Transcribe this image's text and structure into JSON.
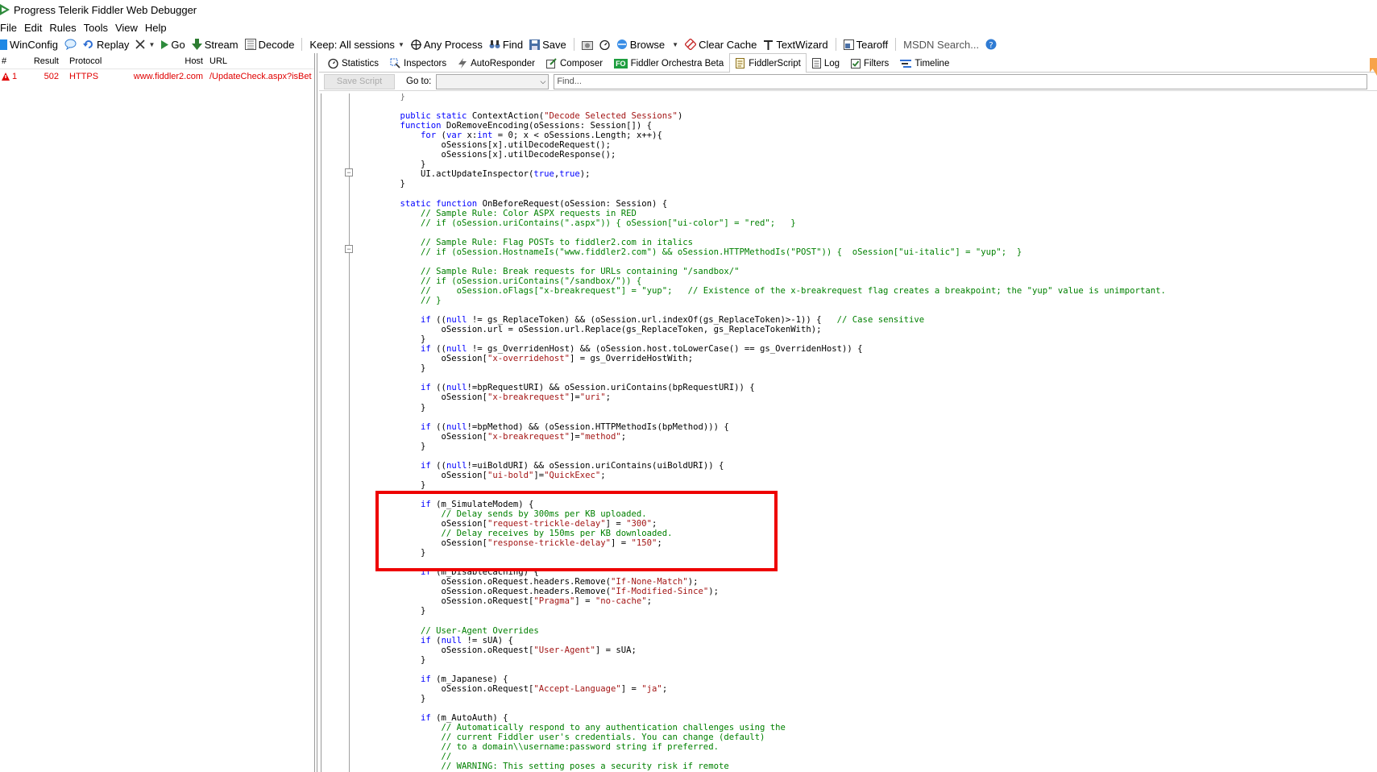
{
  "window": {
    "title": "Progress Telerik Fiddler Web Debugger",
    "icon": "fiddler-logo-icon"
  },
  "menu": [
    "File",
    "Edit",
    "Rules",
    "Tools",
    "View",
    "Help"
  ],
  "toolbar": {
    "winconfig": "WinConfig",
    "replay": "Replay",
    "go": "Go",
    "stream": "Stream",
    "decode": "Decode",
    "keep": "Keep: All sessions",
    "any_process": "Any Process",
    "find": "Find",
    "save": "Save",
    "browse": "Browse",
    "clear_cache": "Clear Cache",
    "textwizard": "TextWizard",
    "tearoff": "Tearoff",
    "msdn_search": "MSDN Search..."
  },
  "sessions": {
    "columns": [
      "#",
      "Result",
      "Protocol",
      "Host",
      "URL"
    ],
    "rows": [
      {
        "num": "1",
        "result": "502",
        "protocol": "HTTPS",
        "host": "www.fiddler2.com",
        "url": "/UpdateCheck.aspx?isBet",
        "status_icon": "warning-icon"
      }
    ]
  },
  "tabs": [
    {
      "label": "Statistics",
      "icon": "stopwatch-icon"
    },
    {
      "label": "Inspectors",
      "icon": "inspect-icon"
    },
    {
      "label": "AutoResponder",
      "icon": "lightning-icon"
    },
    {
      "label": "Composer",
      "icon": "pencil-icon"
    },
    {
      "label": "Fiddler Orchestra Beta",
      "icon": "fo-icon",
      "badge": "FO"
    },
    {
      "label": "FiddlerScript",
      "icon": "script-icon",
      "active": true
    },
    {
      "label": "Log",
      "icon": "log-icon"
    },
    {
      "label": "Filters",
      "icon": "checkbox-icon"
    },
    {
      "label": "Timeline",
      "icon": "timeline-icon"
    }
  ],
  "scriptbar": {
    "save_script": "Save Script",
    "goto_label": "Go to:",
    "goto_value": "",
    "find_placeholder": "Find..."
  },
  "code_lines": [
    [
      [
        "pc",
        "    }"
      ]
    ],
    [],
    [
      [
        "",
        "    "
      ],
      [
        "kw",
        "public static"
      ],
      [
        "",
        " ContextAction("
      ],
      [
        "str",
        "\"Decode Selected Sessions\""
      ],
      [
        "",
        ")"
      ]
    ],
    [
      [
        "",
        "    "
      ],
      [
        "kw",
        "function"
      ],
      [
        "",
        " DoRemoveEncoding(oSessions: Session[]) {"
      ]
    ],
    [
      [
        "",
        "        "
      ],
      [
        "kw",
        "for"
      ],
      [
        "",
        " ("
      ],
      [
        "kw",
        "var"
      ],
      [
        "",
        " x:"
      ],
      [
        "kw",
        "int"
      ],
      [
        "",
        " = 0; x < oSessions.Length; x++){"
      ]
    ],
    [
      [
        "",
        "            oSessions[x].utilDecodeRequest();"
      ]
    ],
    [
      [
        "",
        "            oSessions[x].utilDecodeResponse();"
      ]
    ],
    [
      [
        "",
        "        }"
      ]
    ],
    [
      [
        "",
        "        UI.actUpdateInspector("
      ],
      [
        "kw",
        "true"
      ],
      [
        "",
        ","
      ],
      [
        "kw",
        "true"
      ],
      [
        "",
        ");"
      ]
    ],
    [
      [
        "",
        "    }"
      ]
    ],
    [],
    [
      [
        "",
        "    "
      ],
      [
        "kw",
        "static function"
      ],
      [
        "",
        " OnBeforeRequest(oSession: Session) {"
      ]
    ],
    [
      [
        "cm",
        "        // Sample Rule: Color ASPX requests in RED"
      ]
    ],
    [
      [
        "cm",
        "        // if (oSession.uriContains(\".aspx\")) { oSession[\"ui-color\"] = \"red\";   }"
      ]
    ],
    [],
    [
      [
        "cm",
        "        // Sample Rule: Flag POSTs to fiddler2.com in italics"
      ]
    ],
    [
      [
        "cm",
        "        // if (oSession.HostnameIs(\"www.fiddler2.com\") && oSession.HTTPMethodIs(\"POST\")) {  oSession[\"ui-italic\"] = \"yup\";  }"
      ]
    ],
    [],
    [
      [
        "cm",
        "        // Sample Rule: Break requests for URLs containing \"/sandbox/\""
      ]
    ],
    [
      [
        "cm",
        "        // if (oSession.uriContains(\"/sandbox/\")) {"
      ]
    ],
    [
      [
        "cm",
        "        //     oSession.oFlags[\"x-breakrequest\"] = \"yup\";   // Existence of the x-breakrequest flag creates a breakpoint; the \"yup\" value is unimportant."
      ]
    ],
    [
      [
        "cm",
        "        // }"
      ]
    ],
    [],
    [
      [
        "",
        "        "
      ],
      [
        "kw",
        "if"
      ],
      [
        "",
        " (("
      ],
      [
        "kw",
        "null"
      ],
      [
        "",
        " != gs_ReplaceToken) && (oSession.url.indexOf(gs_ReplaceToken)>-1)) {   "
      ],
      [
        "cm",
        "// Case sensitive"
      ]
    ],
    [
      [
        "",
        "            oSession.url = oSession.url.Replace(gs_ReplaceToken, gs_ReplaceTokenWith);"
      ]
    ],
    [
      [
        "",
        "        }"
      ]
    ],
    [
      [
        "",
        "        "
      ],
      [
        "kw",
        "if"
      ],
      [
        "",
        " (("
      ],
      [
        "kw",
        "null"
      ],
      [
        "",
        " != gs_OverridenHost) && (oSession.host.toLowerCase() == gs_OverridenHost)) {"
      ]
    ],
    [
      [
        "",
        "            oSession["
      ],
      [
        "str",
        "\"x-overridehost\""
      ],
      [
        "",
        "] = gs_OverrideHostWith;"
      ]
    ],
    [
      [
        "",
        "        }"
      ]
    ],
    [],
    [
      [
        "",
        "        "
      ],
      [
        "kw",
        "if"
      ],
      [
        "",
        " (("
      ],
      [
        "kw",
        "null"
      ],
      [
        "",
        "!=bpRequestURI) && oSession.uriContains(bpRequestURI)) {"
      ]
    ],
    [
      [
        "",
        "            oSession["
      ],
      [
        "str",
        "\"x-breakrequest\""
      ],
      [
        "",
        "]="
      ],
      [
        "str",
        "\"uri\""
      ],
      [
        "",
        ";"
      ]
    ],
    [
      [
        "",
        "        }"
      ]
    ],
    [],
    [
      [
        "",
        "        "
      ],
      [
        "kw",
        "if"
      ],
      [
        "",
        " (("
      ],
      [
        "kw",
        "null"
      ],
      [
        "",
        "!=bpMethod) && (oSession.HTTPMethodIs(bpMethod))) {"
      ]
    ],
    [
      [
        "",
        "            oSession["
      ],
      [
        "str",
        "\"x-breakrequest\""
      ],
      [
        "",
        "]="
      ],
      [
        "str",
        "\"method\""
      ],
      [
        "",
        ";"
      ]
    ],
    [
      [
        "",
        "        }"
      ]
    ],
    [],
    [
      [
        "",
        "        "
      ],
      [
        "kw",
        "if"
      ],
      [
        "",
        " (("
      ],
      [
        "kw",
        "null"
      ],
      [
        "",
        "!=uiBoldURI) && oSession.uriContains(uiBoldURI)) {"
      ]
    ],
    [
      [
        "",
        "            oSession["
      ],
      [
        "str",
        "\"ui-bold\""
      ],
      [
        "",
        "]="
      ],
      [
        "str",
        "\"QuickExec\""
      ],
      [
        "",
        ";"
      ]
    ],
    [
      [
        "",
        "        }"
      ]
    ],
    [],
    [
      [
        "",
        "        "
      ],
      [
        "kw",
        "if"
      ],
      [
        "",
        " (m_SimulateModem) {"
      ]
    ],
    [
      [
        "cm",
        "            // Delay sends by 300ms per KB uploaded."
      ]
    ],
    [
      [
        "",
        "            oSession["
      ],
      [
        "str",
        "\"request-trickle-delay\""
      ],
      [
        "",
        "] = "
      ],
      [
        "str",
        "\"300\""
      ],
      [
        "",
        ";"
      ]
    ],
    [
      [
        "cm",
        "            // Delay receives by 150ms per KB downloaded."
      ]
    ],
    [
      [
        "",
        "            oSession["
      ],
      [
        "str",
        "\"response-trickle-delay\""
      ],
      [
        "",
        "] = "
      ],
      [
        "str",
        "\"150\""
      ],
      [
        "",
        ";"
      ]
    ],
    [
      [
        "",
        "        }"
      ]
    ],
    [],
    [
      [
        "",
        "        "
      ],
      [
        "kw",
        "if"
      ],
      [
        "",
        " (m_DisableCaching) {"
      ]
    ],
    [
      [
        "",
        "            oSession.oRequest.headers.Remove("
      ],
      [
        "str",
        "\"If-None-Match\""
      ],
      [
        "",
        ");"
      ]
    ],
    [
      [
        "",
        "            oSession.oRequest.headers.Remove("
      ],
      [
        "str",
        "\"If-Modified-Since\""
      ],
      [
        "",
        ");"
      ]
    ],
    [
      [
        "",
        "            oSession.oRequest["
      ],
      [
        "str",
        "\"Pragma\""
      ],
      [
        "",
        "] = "
      ],
      [
        "str",
        "\"no-cache\""
      ],
      [
        "",
        ";"
      ]
    ],
    [
      [
        "",
        "        }"
      ]
    ],
    [],
    [
      [
        "cm",
        "        // User-Agent Overrides"
      ]
    ],
    [
      [
        "",
        "        "
      ],
      [
        "kw",
        "if"
      ],
      [
        "",
        " ("
      ],
      [
        "kw",
        "null"
      ],
      [
        "",
        " != sUA) {"
      ]
    ],
    [
      [
        "",
        "            oSession.oRequest["
      ],
      [
        "str",
        "\"User-Agent\""
      ],
      [
        "",
        "] = sUA;"
      ]
    ],
    [
      [
        "",
        "        }"
      ]
    ],
    [],
    [
      [
        "",
        "        "
      ],
      [
        "kw",
        "if"
      ],
      [
        "",
        " (m_Japanese) {"
      ]
    ],
    [
      [
        "",
        "            oSession.oRequest["
      ],
      [
        "str",
        "\"Accept-Language\""
      ],
      [
        "",
        "] = "
      ],
      [
        "str",
        "\"ja\""
      ],
      [
        "",
        ";"
      ]
    ],
    [
      [
        "",
        "        }"
      ]
    ],
    [],
    [
      [
        "",
        "        "
      ],
      [
        "kw",
        "if"
      ],
      [
        "",
        " (m_AutoAuth) {"
      ]
    ],
    [
      [
        "cm",
        "            // Automatically respond to any authentication challenges using the"
      ]
    ],
    [
      [
        "cm",
        "            // current Fiddler user's credentials. You can change (default)"
      ]
    ],
    [
      [
        "cm",
        "            // to a domain\\\\username:password string if preferred."
      ]
    ],
    [
      [
        "cm",
        "            //"
      ]
    ],
    [
      [
        "cm",
        "            // WARNING: This setting poses a security risk if remote"
      ]
    ]
  ],
  "colors": {
    "keyword": "#0000ff",
    "string": "#a31515",
    "comment": "#008000",
    "error_row": "#e00000",
    "highlight_box": "#ee0000"
  }
}
